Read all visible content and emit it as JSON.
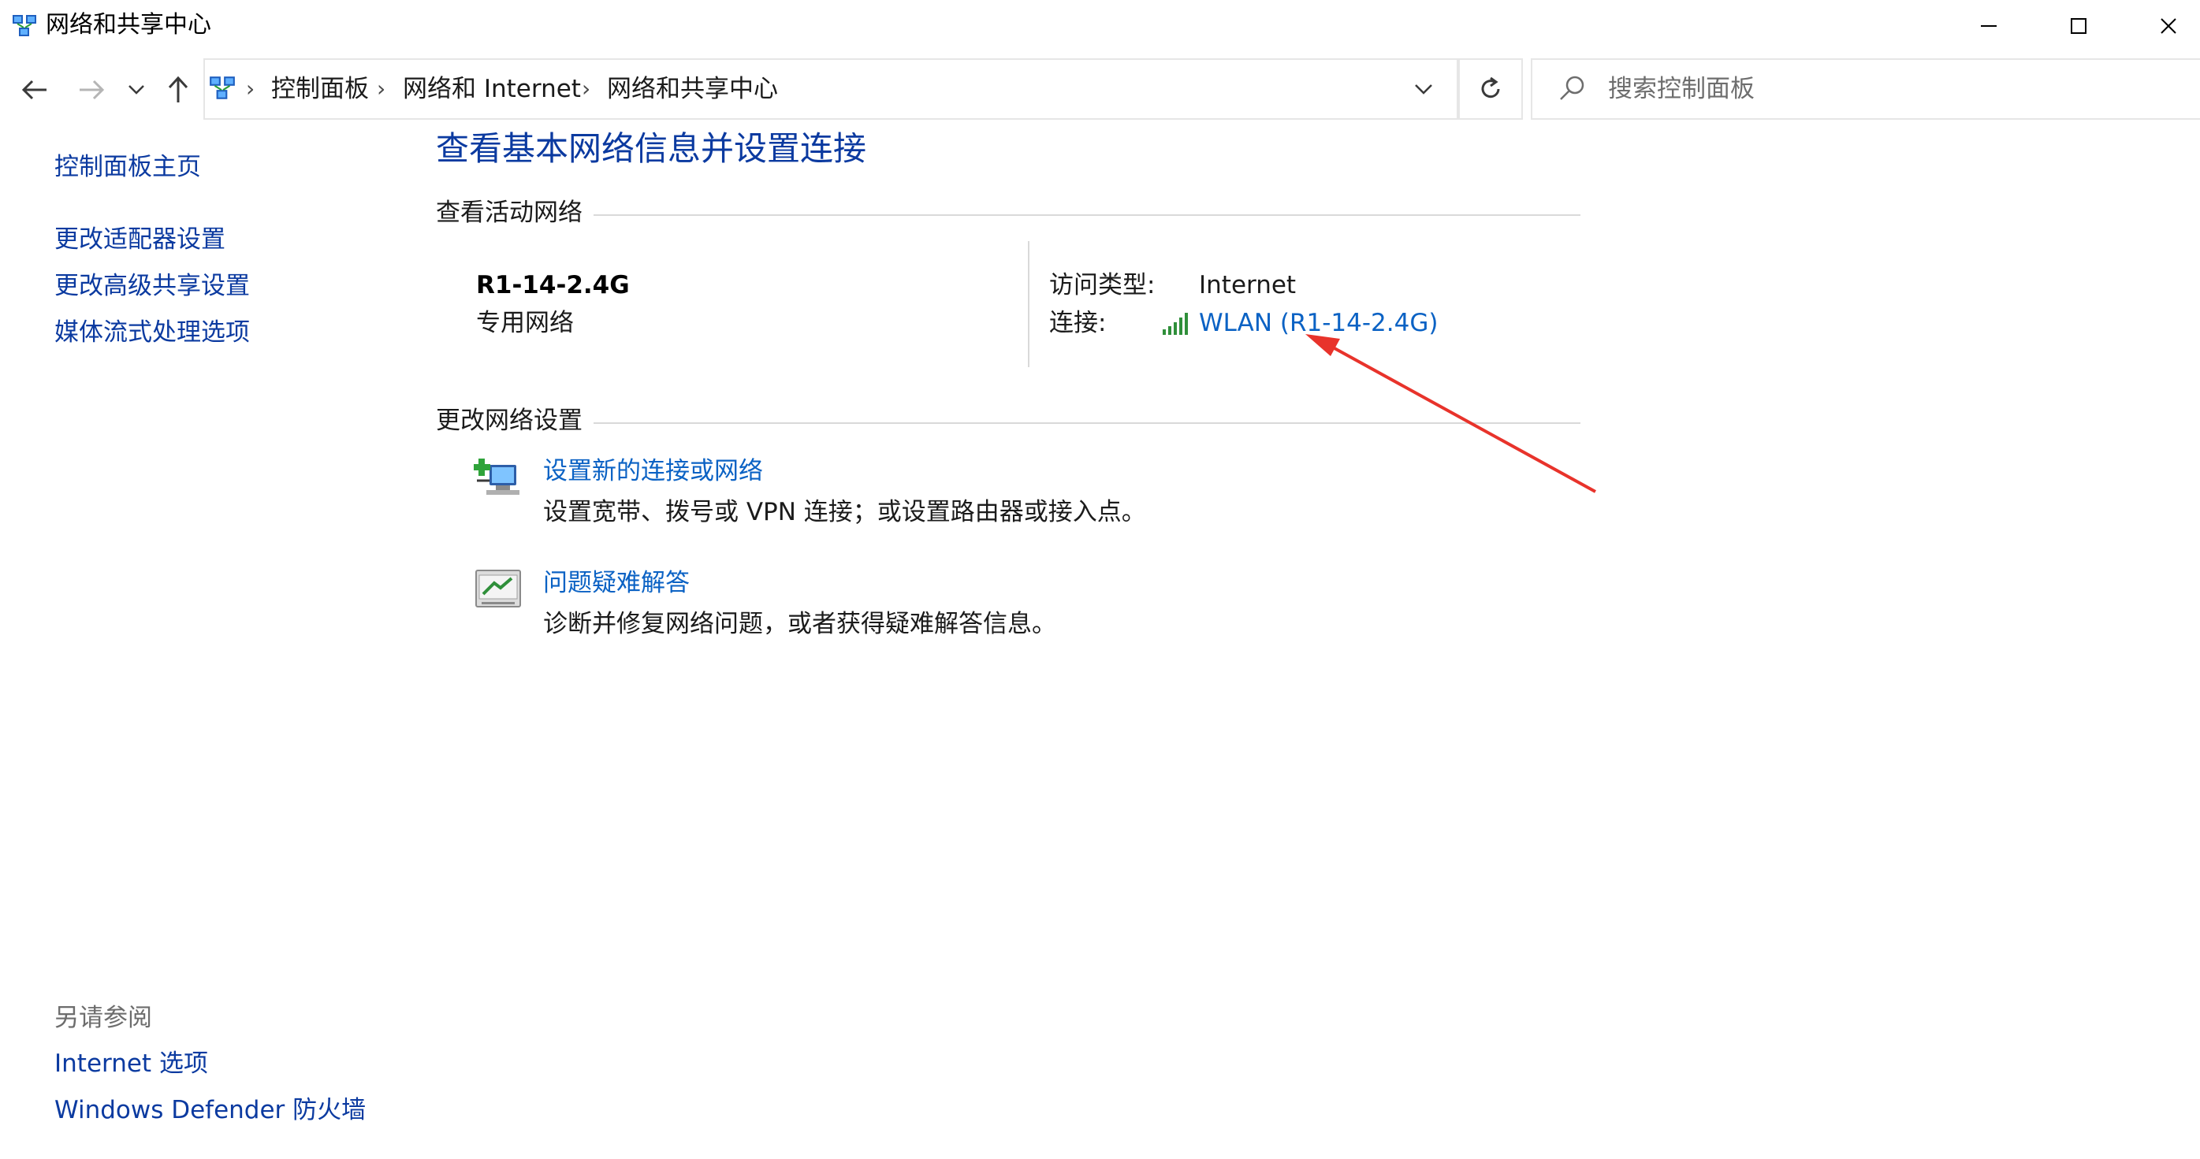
{
  "window": {
    "title": "网络和共享中心",
    "icon": "network-sharing-center-icon",
    "controls": {
      "minimize": "minimize-icon",
      "maximize": "maximize-icon",
      "close": "close-icon"
    }
  },
  "address_bar": {
    "breadcrumbs": [
      "控制面板",
      "网络和 Internet",
      "网络和共享中心"
    ],
    "search": {
      "placeholder": "搜索控制面板",
      "value": ""
    }
  },
  "sidebar": {
    "home": "控制面板主页",
    "links": [
      "更改适配器设置",
      "更改高级共享设置",
      "媒体流式处理选项"
    ],
    "see_also": {
      "label": "另请参阅",
      "links": [
        "Internet 选项",
        "Windows Defender 防火墙"
      ]
    }
  },
  "main": {
    "title": "查看基本网络信息并设置连接",
    "active_networks": {
      "label": "查看活动网络",
      "network_name": "R1-14-2.4G",
      "network_type": "专用网络",
      "access_type_label": "访问类型:",
      "access_type_value": "Internet",
      "connection_label": "连接:",
      "connection_value": "WLAN (R1-14-2.4G)"
    },
    "change_settings": {
      "label": "更改网络设置",
      "tasks": [
        {
          "title": "设置新的连接或网络",
          "description": "设置宽带、拨号或 VPN 连接；或设置路由器或接入点。",
          "icon": "new-connection-icon"
        },
        {
          "title": "问题疑难解答",
          "description": "诊断并修复网络问题，或者获得疑难解答信息。",
          "icon": "troubleshoot-icon"
        }
      ]
    }
  },
  "colors": {
    "link": "#0b62c4",
    "title": "#0b3aa0",
    "annotation_arrow": "#e8332b"
  }
}
